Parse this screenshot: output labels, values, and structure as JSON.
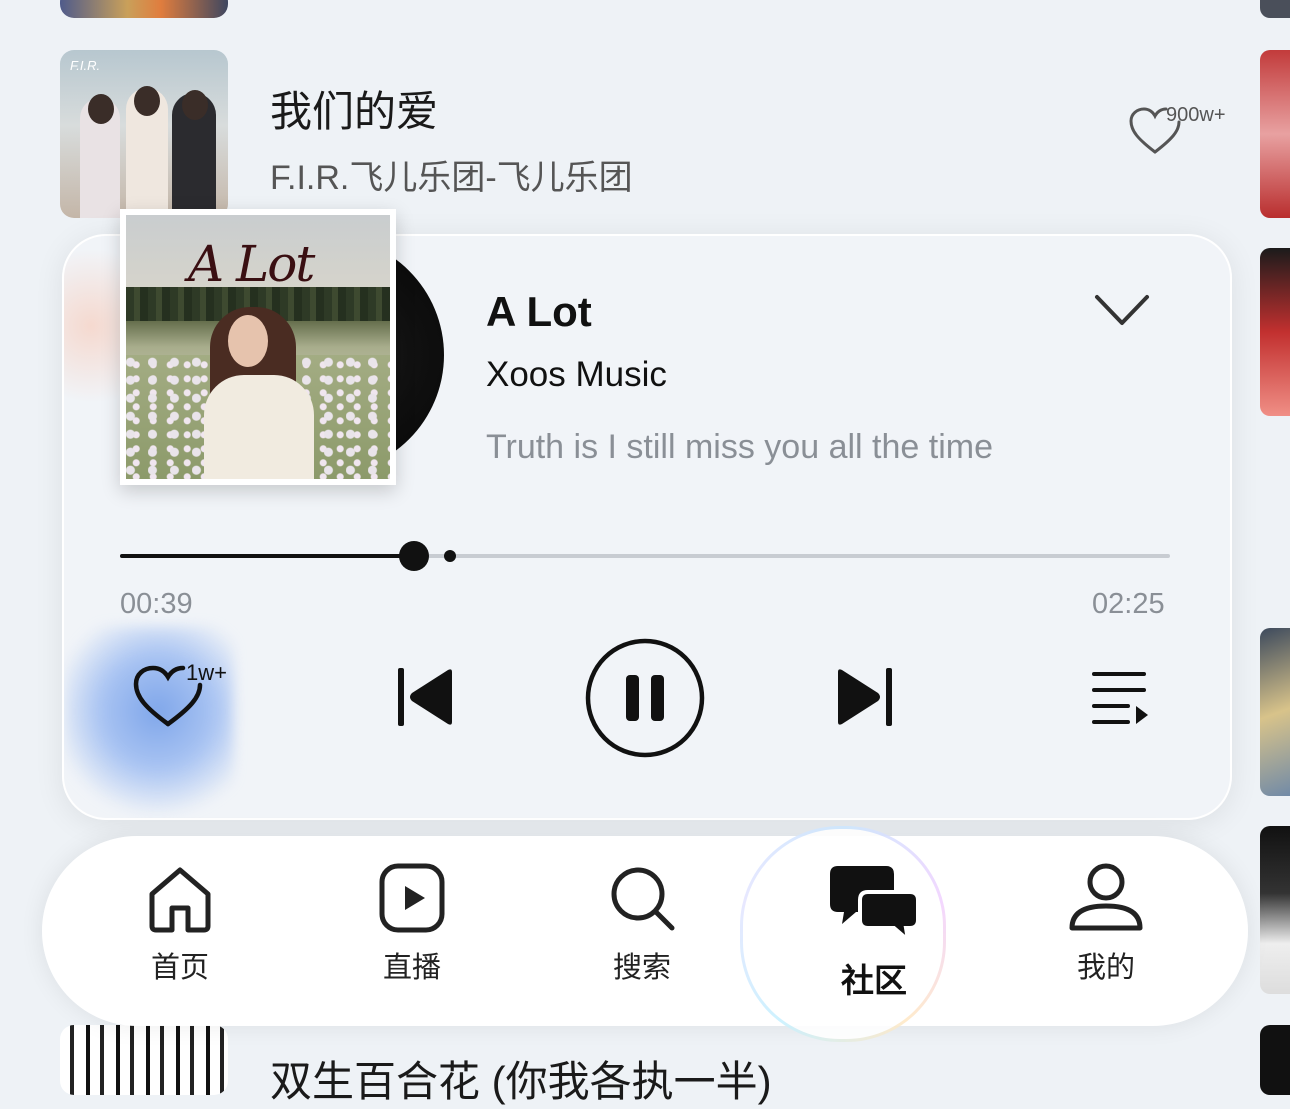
{
  "list": {
    "row1": {
      "title": "我们的爱",
      "artist": "F.I.R.飞儿乐团-飞儿乐团",
      "like_count": "900w+"
    },
    "row2": {
      "title": "双生百合花 (你我各执一半)"
    }
  },
  "player": {
    "album_script": "A Lot",
    "title": "A Lot",
    "artist": "Xoos Music",
    "lyric": "Truth is I still miss you all the time",
    "current_time": "00:39",
    "total_time": "02:25",
    "progress_fraction": 0.28,
    "buffer_fraction": 0.314,
    "like_count": "1w+"
  },
  "tabs": [
    {
      "label": "首页",
      "icon": "home-icon"
    },
    {
      "label": "直播",
      "icon": "live-play-icon"
    },
    {
      "label": "搜索",
      "icon": "search-icon"
    },
    {
      "label": "社区",
      "icon": "chat-bubbles-icon",
      "active": true
    },
    {
      "label": "我的",
      "icon": "person-icon"
    }
  ]
}
